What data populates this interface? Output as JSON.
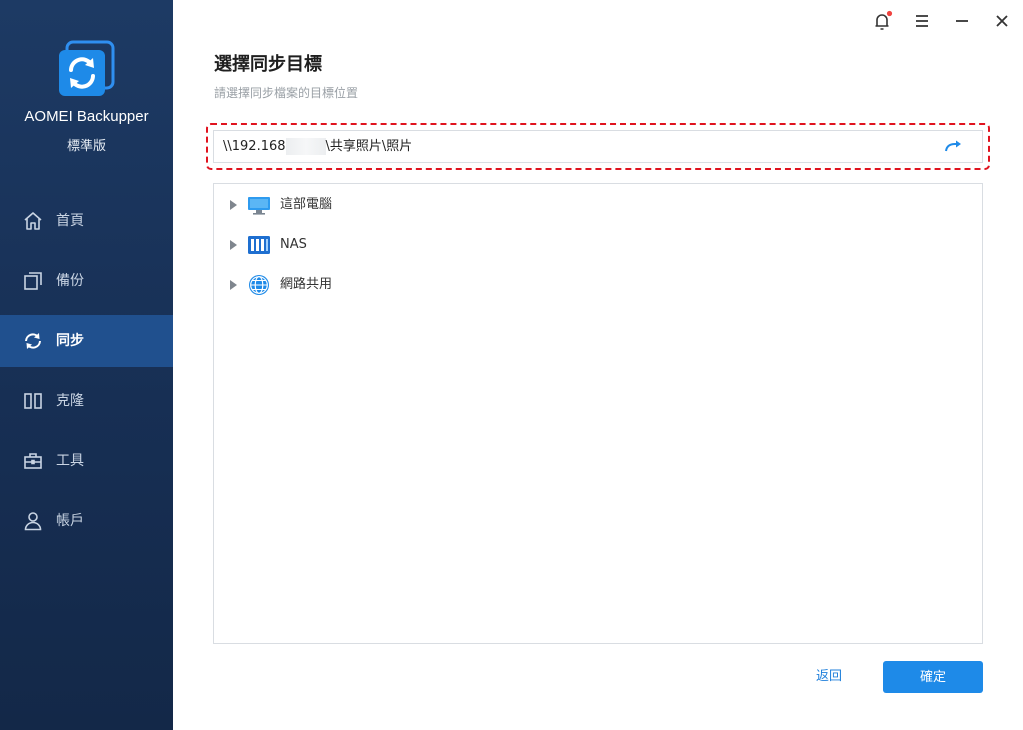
{
  "app": {
    "name": "AOMEI Backupper",
    "edition": "標準版"
  },
  "sidebar": {
    "items": [
      {
        "label": "首頁",
        "icon": "home-icon"
      },
      {
        "label": "備份",
        "icon": "backup-icon"
      },
      {
        "label": "同步",
        "icon": "sync-icon",
        "active": true
      },
      {
        "label": "克隆",
        "icon": "clone-icon"
      },
      {
        "label": "工具",
        "icon": "tools-icon"
      },
      {
        "label": "帳戶",
        "icon": "user-icon"
      }
    ]
  },
  "window_controls": [
    "bell-icon",
    "menu-icon",
    "minimize-icon",
    "close-icon"
  ],
  "main": {
    "title": "選擇同步目標",
    "subtitle": "請選擇同步檔案的目標位置",
    "path_prefix": "\\\\192.168",
    "path_suffix": "\\共享照片\\照片",
    "tree": [
      {
        "label": "這部電腦",
        "icon": "computer-icon"
      },
      {
        "label": "NAS",
        "icon": "nas-icon"
      },
      {
        "label": "網路共用",
        "icon": "network-share-icon"
      }
    ],
    "back_label": "返回",
    "ok_label": "確定"
  },
  "colors": {
    "sidebar_bg": "#1d3a64",
    "active_item": "#20508e",
    "accent": "#1e8ae8",
    "highlight": "#e0131f"
  }
}
